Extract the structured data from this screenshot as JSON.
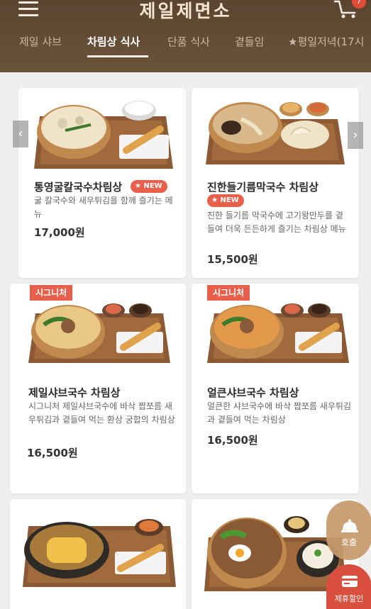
{
  "header": {
    "logo": "제일제면소",
    "cart_count": "7"
  },
  "tabs": [
    {
      "label": "제일 샤브"
    },
    {
      "label": "차림상 식사"
    },
    {
      "label": "단품 식사"
    },
    {
      "label": "곁들임"
    },
    {
      "label": "★평일저녁(17시"
    }
  ],
  "cards": [
    {
      "title": "통영굴칼국수차림상",
      "badge": "NEW",
      "desc": "굴 칼국수와 새우튀김을 함께 즐기는 메뉴",
      "price": "17,000원"
    },
    {
      "title": "진한들기름막국수 차림상",
      "badge": "NEW",
      "desc": "진한 들기름 막국수에 고기왕만두를 곁들여 더욱 든든하게 즐기는 차림상 메뉴",
      "price": "15,500원"
    },
    {
      "title": "제일샤브국수 차림상",
      "badge": "시그니처",
      "desc": "시그니처 제일샤브국수에 바삭 짭쪼름 새우튀김과 곁들여 먹는 환상 궁합의 차림상",
      "price": "16,500원"
    },
    {
      "title": "얼큰샤브국수 차림상",
      "badge": "시그니처",
      "desc": "얼큰한 샤브국수에 바삭 짭쪼름 새우튀김과 곁들여 먹는 차림상",
      "price": "16,500원"
    },
    {
      "title": "",
      "badge": "",
      "desc": "",
      "price": ""
    },
    {
      "title": "",
      "badge": "",
      "desc": "",
      "price": ""
    }
  ],
  "floating": {
    "call_label": "호출",
    "discount_label": "제휴할인"
  },
  "colors": {
    "header_bg": "#5b4530",
    "badge": "#e8604c",
    "tray": "#8b5a34"
  }
}
